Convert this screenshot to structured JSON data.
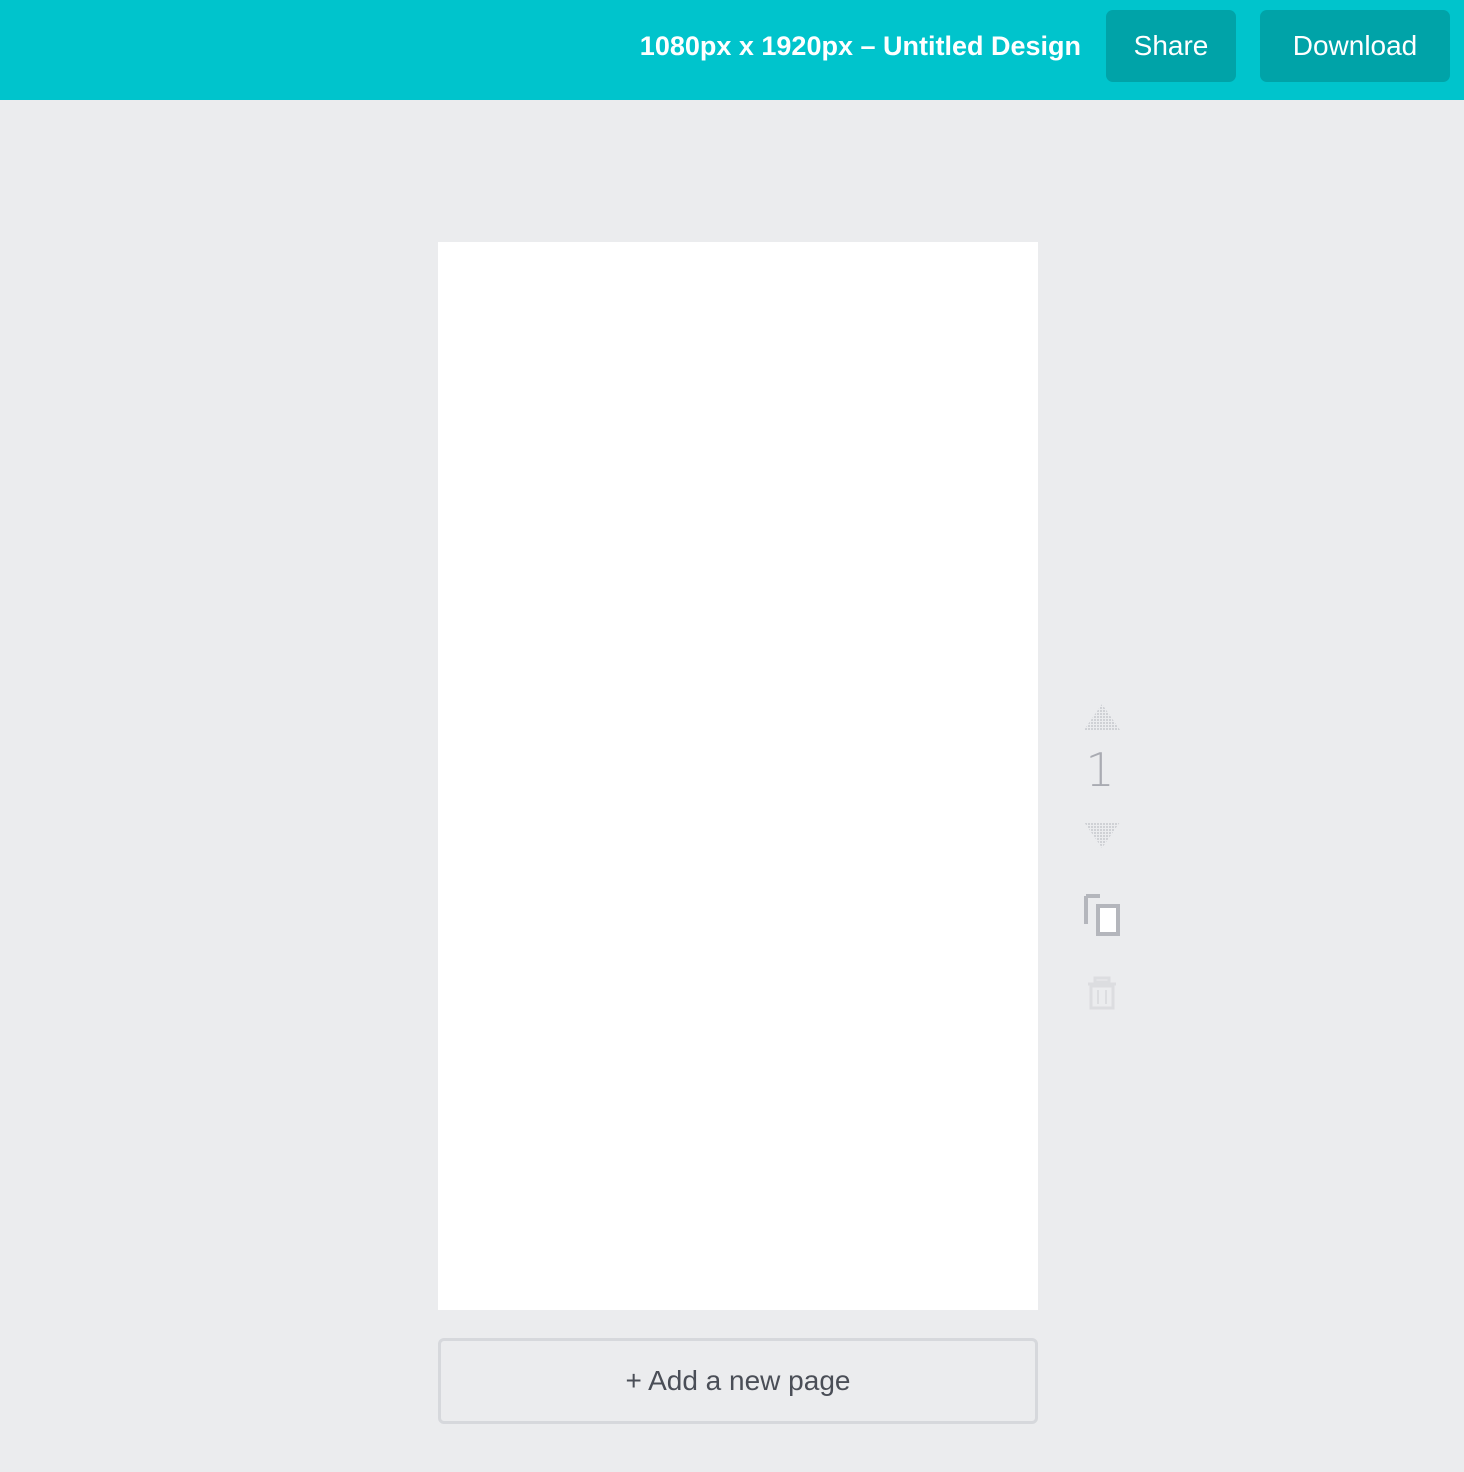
{
  "header": {
    "title": "1080px x 1920px – Untitled Design",
    "share_label": "Share",
    "download_label": "Download",
    "background_color": "#00c4cc",
    "button_color": "#00a3a8"
  },
  "page_controls": {
    "page_number": "1",
    "icons": [
      "move-up-icon",
      "move-down-icon",
      "duplicate-page-icon",
      "delete-page-icon"
    ]
  },
  "footer": {
    "add_page_label": "+ Add a new page"
  }
}
